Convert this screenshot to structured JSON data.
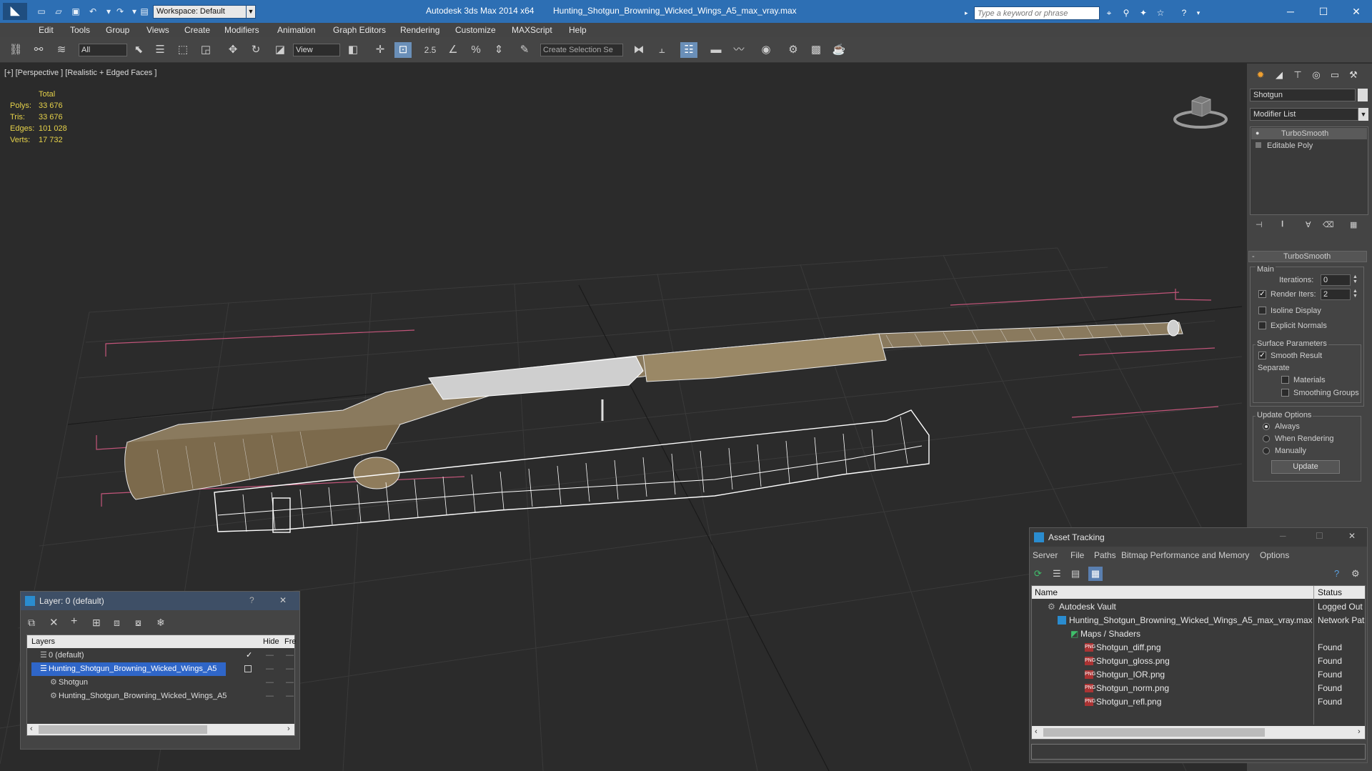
{
  "titlebar": {
    "app_title": "Autodesk 3ds Max  2014 x64",
    "file_title": "Hunting_Shotgun_Browning_Wicked_Wings_A5_max_vray.max",
    "workspace": "Workspace: Default",
    "search_placeholder": "Type a keyword or phrase"
  },
  "menu": [
    "Edit",
    "Tools",
    "Group",
    "Views",
    "Create",
    "Modifiers",
    "Animation",
    "Graph Editors",
    "Rendering",
    "Customize",
    "MAXScript",
    "Help"
  ],
  "toolbar": {
    "selection_filter": "All",
    "ref_coord": "View",
    "snap_label": "2.5",
    "selection_set_placeholder": "Create Selection Se"
  },
  "viewport": {
    "label": "[+] [Perspective ] [Realistic + Edged Faces ]",
    "stats_header": "Total",
    "stats": [
      {
        "label": "Polys:",
        "value": "33 676"
      },
      {
        "label": "Tris:",
        "value": "33 676"
      },
      {
        "label": "Edges:",
        "value": "101 028"
      },
      {
        "label": "Verts:",
        "value": "17 732"
      }
    ]
  },
  "command_panel": {
    "object_name": "Shotgun",
    "modifier_list": "Modifier List",
    "stack": [
      "TurboSmooth",
      "Editable Poly"
    ],
    "rollout_title": "TurboSmooth",
    "main_label": "Main",
    "iterations_label": "Iterations:",
    "iterations_value": "0",
    "render_iters_label": "Render Iters:",
    "render_iters_value": "2",
    "render_iters_checked": true,
    "isoline_label": "Isoline Display",
    "explicit_normals_label": "Explicit Normals",
    "surface_params_label": "Surface Parameters",
    "smooth_result_label": "Smooth Result",
    "separate_label": "Separate",
    "materials_label": "Materials",
    "smoothing_groups_label": "Smoothing Groups",
    "update_options_label": "Update Options",
    "always_label": "Always",
    "when_rendering_label": "When Rendering",
    "manually_label": "Manually",
    "update_button": "Update"
  },
  "layer_dialog": {
    "title": "Layer: 0 (default)",
    "col_layers": "Layers",
    "col_hide": "Hide",
    "col_freeze": "Fre",
    "rows": [
      {
        "name": "0 (default)",
        "indent": 0
      },
      {
        "name": "Hunting_Shotgun_Browning_Wicked_Wings_A5",
        "indent": 0
      },
      {
        "name": "Shotgun",
        "indent": 1
      },
      {
        "name": "Hunting_Shotgun_Browning_Wicked_Wings_A5",
        "indent": 1
      }
    ]
  },
  "asset_dialog": {
    "title": "Asset Tracking",
    "menu": [
      "Server",
      "File",
      "Paths",
      "Bitmap Performance and Memory",
      "Options"
    ],
    "col_name": "Name",
    "col_status": "Status",
    "rows": [
      {
        "name": "Autodesk Vault",
        "status": "Logged Out"
      },
      {
        "name": "Hunting_Shotgun_Browning_Wicked_Wings_A5_max_vray.max",
        "status": "Network Pat"
      },
      {
        "name": "Maps / Shaders",
        "status": ""
      },
      {
        "name": "Shotgun_diff.png",
        "status": "Found"
      },
      {
        "name": "Shotgun_gloss.png",
        "status": "Found"
      },
      {
        "name": "Shotgun_IOR.png",
        "status": "Found"
      },
      {
        "name": "Shotgun_norm.png",
        "status": "Found"
      },
      {
        "name": "Shotgun_refl.png",
        "status": "Found"
      }
    ]
  },
  "colors": {
    "titlebar": "#2d6fb4",
    "stats_text": "#e6d24a",
    "selected_layer": "#2f66c8",
    "grid_line": "#3a3a3a",
    "pink_guides": "#c2557a"
  }
}
